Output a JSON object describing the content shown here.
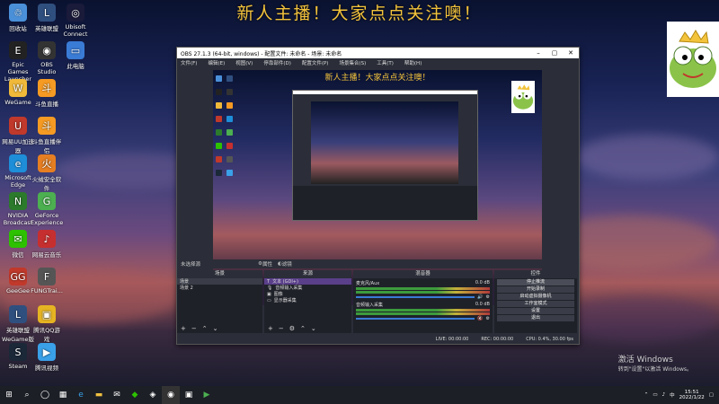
{
  "overlay_title": "新人主播！大家点点关注噢！",
  "desktop_icons": [
    {
      "label": "回收站",
      "color": "#4a90d9",
      "glyph": "♲"
    },
    {
      "label": "英雄联盟",
      "color": "#2f4f7f",
      "glyph": "L"
    },
    {
      "label": "Ubisoft Connect",
      "color": "#1a1a3a",
      "glyph": "◎"
    },
    {
      "label": "Epic Games Launcher",
      "color": "#222",
      "glyph": "E"
    },
    {
      "label": "OBS Studio",
      "color": "#333",
      "glyph": "◉"
    },
    {
      "label": "此电脑",
      "color": "#3a7bd5",
      "glyph": "▭"
    },
    {
      "label": "WeGame",
      "color": "#f0b93a",
      "glyph": "W"
    },
    {
      "label": "斗鱼直播",
      "color": "#f59a23",
      "glyph": "斗"
    },
    {
      "label": "网易UU加速器",
      "color": "#c0392b",
      "glyph": "U"
    },
    {
      "label": "斗鱼直播伴侣",
      "color": "#f59a23",
      "glyph": "斗"
    },
    {
      "label": "Microsoft Edge",
      "color": "#1e8ed9",
      "glyph": "e"
    },
    {
      "label": "火绒安全软件",
      "color": "#e67e22",
      "glyph": "火"
    },
    {
      "label": "NVIDIA Broadcast",
      "color": "#2c7a2c",
      "glyph": "N"
    },
    {
      "label": "GeForce Experience",
      "color": "#4caf50",
      "glyph": "G"
    },
    {
      "label": "微信",
      "color": "#2dc100",
      "glyph": "✉"
    },
    {
      "label": "网易云音乐",
      "color": "#c62f2f",
      "glyph": "♪"
    },
    {
      "label": "GeeGee",
      "color": "#c0392b",
      "glyph": "GG"
    },
    {
      "label": "FUNGTrai...",
      "color": "#555",
      "glyph": "F"
    },
    {
      "label": "英雄联盟WeGame版",
      "color": "#2f4f7f",
      "glyph": "L"
    },
    {
      "label": "腾讯QQ游戏",
      "color": "#e6b422",
      "glyph": "▣"
    },
    {
      "label": "Steam",
      "color": "#1b2838",
      "glyph": "S"
    },
    {
      "label": "腾讯视频",
      "color": "#3aa0e8",
      "glyph": "▶"
    }
  ],
  "obs": {
    "title": "OBS 27.1.3 (64-bit, windows) - 配置文件: 未命名 - 场景: 未命名",
    "menu": [
      "文件(F)",
      "编辑(E)",
      "视图(V)",
      "停靠部件(D)",
      "配置文件(P)",
      "场景集合(S)",
      "工具(T)",
      "帮助(H)"
    ],
    "preview_title": "新人主播！大家点点关注噢！",
    "source_bar": {
      "label": "未选择源",
      "props": "属性",
      "filters": "滤镜"
    },
    "scenes": {
      "header": "场景",
      "items": [
        "场景",
        "场景 2"
      ]
    },
    "sources": {
      "header": "来源",
      "items": [
        "文本 (GDI+)",
        "音频输入采集",
        "图像",
        "显示器采集"
      ]
    },
    "mixer": {
      "header": "混音器",
      "channels": [
        {
          "name": "麦克风/Aux",
          "db": "0.0 dB"
        },
        {
          "name": "音频输入采集",
          "db": "0.0 dB"
        }
      ]
    },
    "controls": {
      "header": "控件",
      "buttons": [
        "停止推流",
        "开始录制",
        "启动虚拟摄像机",
        "工作室模式",
        "设置",
        "退出"
      ]
    },
    "status": {
      "live": "LIVE: 00:00:00",
      "rec": "REC: 00:00:00",
      "cpu": "CPU: 0.4%, 30.00 fps"
    }
  },
  "watermark": {
    "title": "激活 Windows",
    "subtitle": "转到\"设置\"以激活 Windows。"
  },
  "taskbar": {
    "time": "15:51",
    "date": "2022/1/22"
  }
}
